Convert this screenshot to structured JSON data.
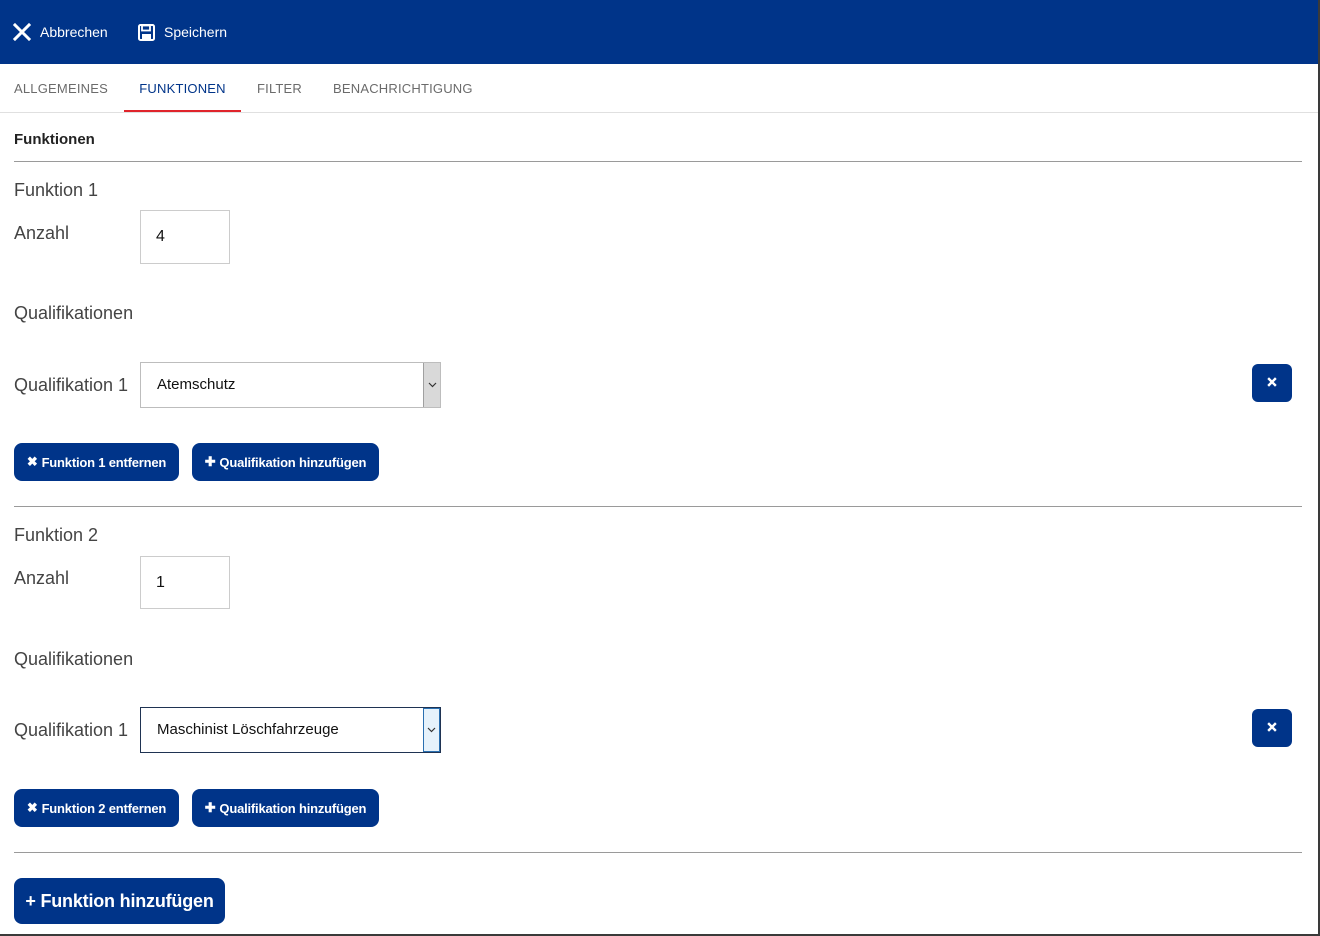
{
  "toolbar": {
    "cancel_label": "Abbrechen",
    "save_label": "Speichern",
    "cancel_icon": "close-icon",
    "save_icon": "floppy-disk-icon"
  },
  "tabs": [
    {
      "label": "ALLGEMEINES",
      "active": false
    },
    {
      "label": "FUNKTIONEN",
      "active": true
    },
    {
      "label": "FILTER",
      "active": false
    },
    {
      "label": "BENACHRICHTIGUNG",
      "active": false
    }
  ],
  "section_title": "Funktionen",
  "functions": [
    {
      "title": "Funktion 1",
      "count_label": "Anzahl",
      "count_value": "4",
      "qualifications_heading": "Qualifikationen",
      "qualifications": [
        {
          "label": "Qualifikation 1",
          "value": "Atemschutz"
        }
      ],
      "remove_label": "Funktion 1 entfernen",
      "add_qualification_label": "Qualifikation hinzufügen"
    },
    {
      "title": "Funktion 2",
      "count_label": "Anzahl",
      "count_value": "1",
      "qualifications_heading": "Qualifikationen",
      "qualifications": [
        {
          "label": "Qualifikation 1",
          "value": "Maschinist Löschfahrzeuge"
        }
      ],
      "remove_label": "Funktion 2 entfernen",
      "add_qualification_label": "Qualifikation hinzufügen"
    }
  ],
  "add_function_label": "+ Funktion hinzufügen",
  "colors": {
    "primary": "#003489",
    "tab_active_underline": "#e0242b"
  }
}
